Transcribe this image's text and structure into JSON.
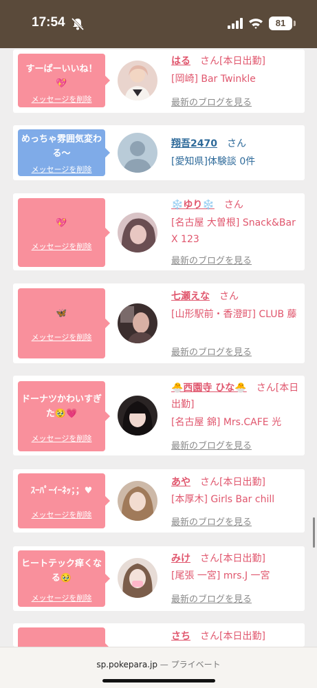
{
  "status_bar": {
    "time": "17:54",
    "battery": "81",
    "bell_icon": "bell-slash-icon",
    "signal_icon": "cellular-signal-icon",
    "wifi_icon": "wifi-icon"
  },
  "messages": [
    {
      "bubble": "すーぱーいいね！💖",
      "bubble_color": "#f9909c",
      "delete": "メッセージを削除",
      "name": "はる",
      "san": "さん",
      "badge": "[本日出勤]",
      "shop": "[岡崎] Bar Twinkle",
      "blog": "最新のブログを見る",
      "avatar": "girl-photo"
    },
    {
      "bubble": "めっちゃ雰囲気変わる〜",
      "bubble_color": "#7fabe8",
      "delete": "メッセージを削除",
      "name": "翔吾2470",
      "san": "さん",
      "badge": "",
      "shop": "[愛知県]体験談 0件",
      "blog": "",
      "avatar": "no-photo-silhouette"
    },
    {
      "bubble": "💖",
      "bubble_color": "#f9909c",
      "delete": "メッセージを削除",
      "name": "❄️ゆり❄️",
      "san": "さん",
      "badge": "",
      "shop": "[名古屋 大曽根] Snack&Bar X 123",
      "blog": "最新のブログを見る",
      "avatar": "girl-photo"
    },
    {
      "bubble": "🦋",
      "bubble_color": "#f9909c",
      "delete": "メッセージを削除",
      "name": "七瀬えな",
      "san": "さん",
      "badge": "",
      "shop": "[山形駅前・香澄町] CLUB 藤",
      "blog": "最新のブログを見る",
      "avatar": "girl-photo"
    },
    {
      "bubble": "ドーナツかわいすぎた🥹💗",
      "bubble_color": "#f9909c",
      "delete": "メッセージを削除",
      "name": "🐣西園寺 ひな🐣",
      "san": "さん",
      "badge": "[本日出勤]",
      "shop": "[名古屋 錦] Mrs.CAFE 光",
      "blog": "最新のブログを見る",
      "avatar": "girl-photo"
    },
    {
      "bubble": "ｽｰﾊﾟｰｲｰﾈｯ；；♥",
      "bubble_color": "#f9909c",
      "delete": "メッセージを削除",
      "name": "あや",
      "san": "さん",
      "badge": "[本日出勤]",
      "shop": "[本厚木] Girls Bar chill",
      "blog": "最新のブログを見る",
      "avatar": "girl-photo"
    },
    {
      "bubble": "ヒートテック痒くなる🥹",
      "bubble_color": "#f9909c",
      "delete": "メッセージを削除",
      "name": "みけ",
      "san": "さん",
      "badge": "[本日出勤]",
      "shop": "[尾張 一宮] mrs.J 一宮",
      "blog": "最新のブログを見る",
      "avatar": "girl-photo"
    },
    {
      "bubble": "",
      "bubble_color": "#f9909c",
      "delete": "",
      "name": "さち",
      "san": "さん",
      "badge": "[本日出勤]",
      "shop": "",
      "blog": "",
      "avatar": "girl-photo"
    }
  ],
  "browser": {
    "url": "sp.pokepara.jp",
    "mode": "— プライベート"
  }
}
